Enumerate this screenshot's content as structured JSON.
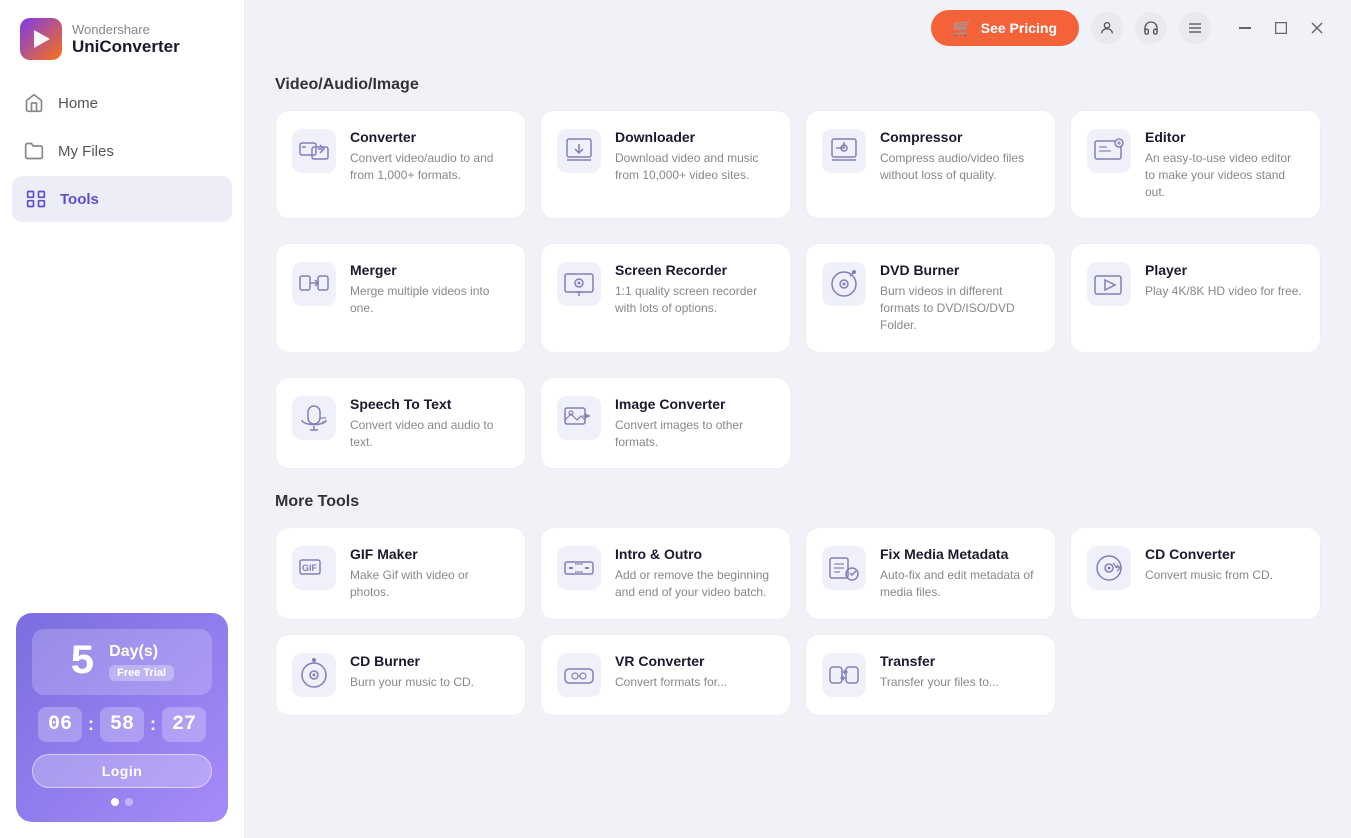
{
  "app": {
    "name": "Wondershare",
    "product": "UniConverter",
    "logo_color_top": "#7c3aed",
    "logo_color_bottom": "#f97316"
  },
  "sidebar": {
    "nav_items": [
      {
        "id": "home",
        "label": "Home",
        "icon": "home-icon",
        "active": false
      },
      {
        "id": "my-files",
        "label": "My Files",
        "icon": "folder-icon",
        "active": false
      },
      {
        "id": "tools",
        "label": "Tools",
        "icon": "tools-icon",
        "active": true
      }
    ]
  },
  "trial": {
    "days_number": "5",
    "days_label": "Day(s)",
    "badge": "Free Trial",
    "countdown": {
      "hours": "06",
      "minutes": "58",
      "seconds": "27"
    },
    "login_label": "Login",
    "dots": [
      true,
      false
    ]
  },
  "header": {
    "see_pricing_label": "See Pricing",
    "icons": [
      "user-icon",
      "headset-icon",
      "menu-icon"
    ],
    "window_controls": [
      "minimize",
      "maximize",
      "close"
    ]
  },
  "sections": {
    "video_audio_image": {
      "title": "Video/Audio/Image",
      "tools": [
        {
          "id": "converter",
          "title": "Converter",
          "desc": "Convert video/audio to and from 1,000+ formats."
        },
        {
          "id": "downloader",
          "title": "Downloader",
          "desc": "Download video and music from 10,000+ video sites."
        },
        {
          "id": "compressor",
          "title": "Compressor",
          "desc": "Compress audio/video files without loss of quality."
        },
        {
          "id": "editor",
          "title": "Editor",
          "desc": "An easy-to-use video editor to make your videos stand out."
        },
        {
          "id": "merger",
          "title": "Merger",
          "desc": "Merge multiple videos into one."
        },
        {
          "id": "screen-recorder",
          "title": "Screen Recorder",
          "desc": "1:1 quality screen recorder with lots of options."
        },
        {
          "id": "dvd-burner",
          "title": "DVD Burner",
          "desc": "Burn videos in different formats to DVD/ISO/DVD Folder."
        },
        {
          "id": "player",
          "title": "Player",
          "desc": "Play 4K/8K HD video for free."
        },
        {
          "id": "speech-to-text",
          "title": "Speech To Text",
          "desc": "Convert video and audio to text."
        },
        {
          "id": "image-converter",
          "title": "Image Converter",
          "desc": "Convert images to other formats."
        }
      ]
    },
    "more_tools": {
      "title": "More Tools",
      "tools": [
        {
          "id": "gif-maker",
          "title": "GIF Maker",
          "desc": "Make Gif with video or photos."
        },
        {
          "id": "intro-outro",
          "title": "Intro & Outro",
          "desc": "Add or remove the beginning and end of your video batch."
        },
        {
          "id": "fix-media-metadata",
          "title": "Fix Media Metadata",
          "desc": "Auto-fix and edit metadata of media files."
        },
        {
          "id": "cd-converter",
          "title": "CD Converter",
          "desc": "Convert music from CD."
        },
        {
          "id": "cd-burner",
          "title": "CD Burner",
          "desc": "Burn your music to CD."
        },
        {
          "id": "vr-converter",
          "title": "VR Converter",
          "desc": "Convert formats for..."
        },
        {
          "id": "transfer",
          "title": "Transfer",
          "desc": "Transfer your files to..."
        }
      ]
    }
  }
}
